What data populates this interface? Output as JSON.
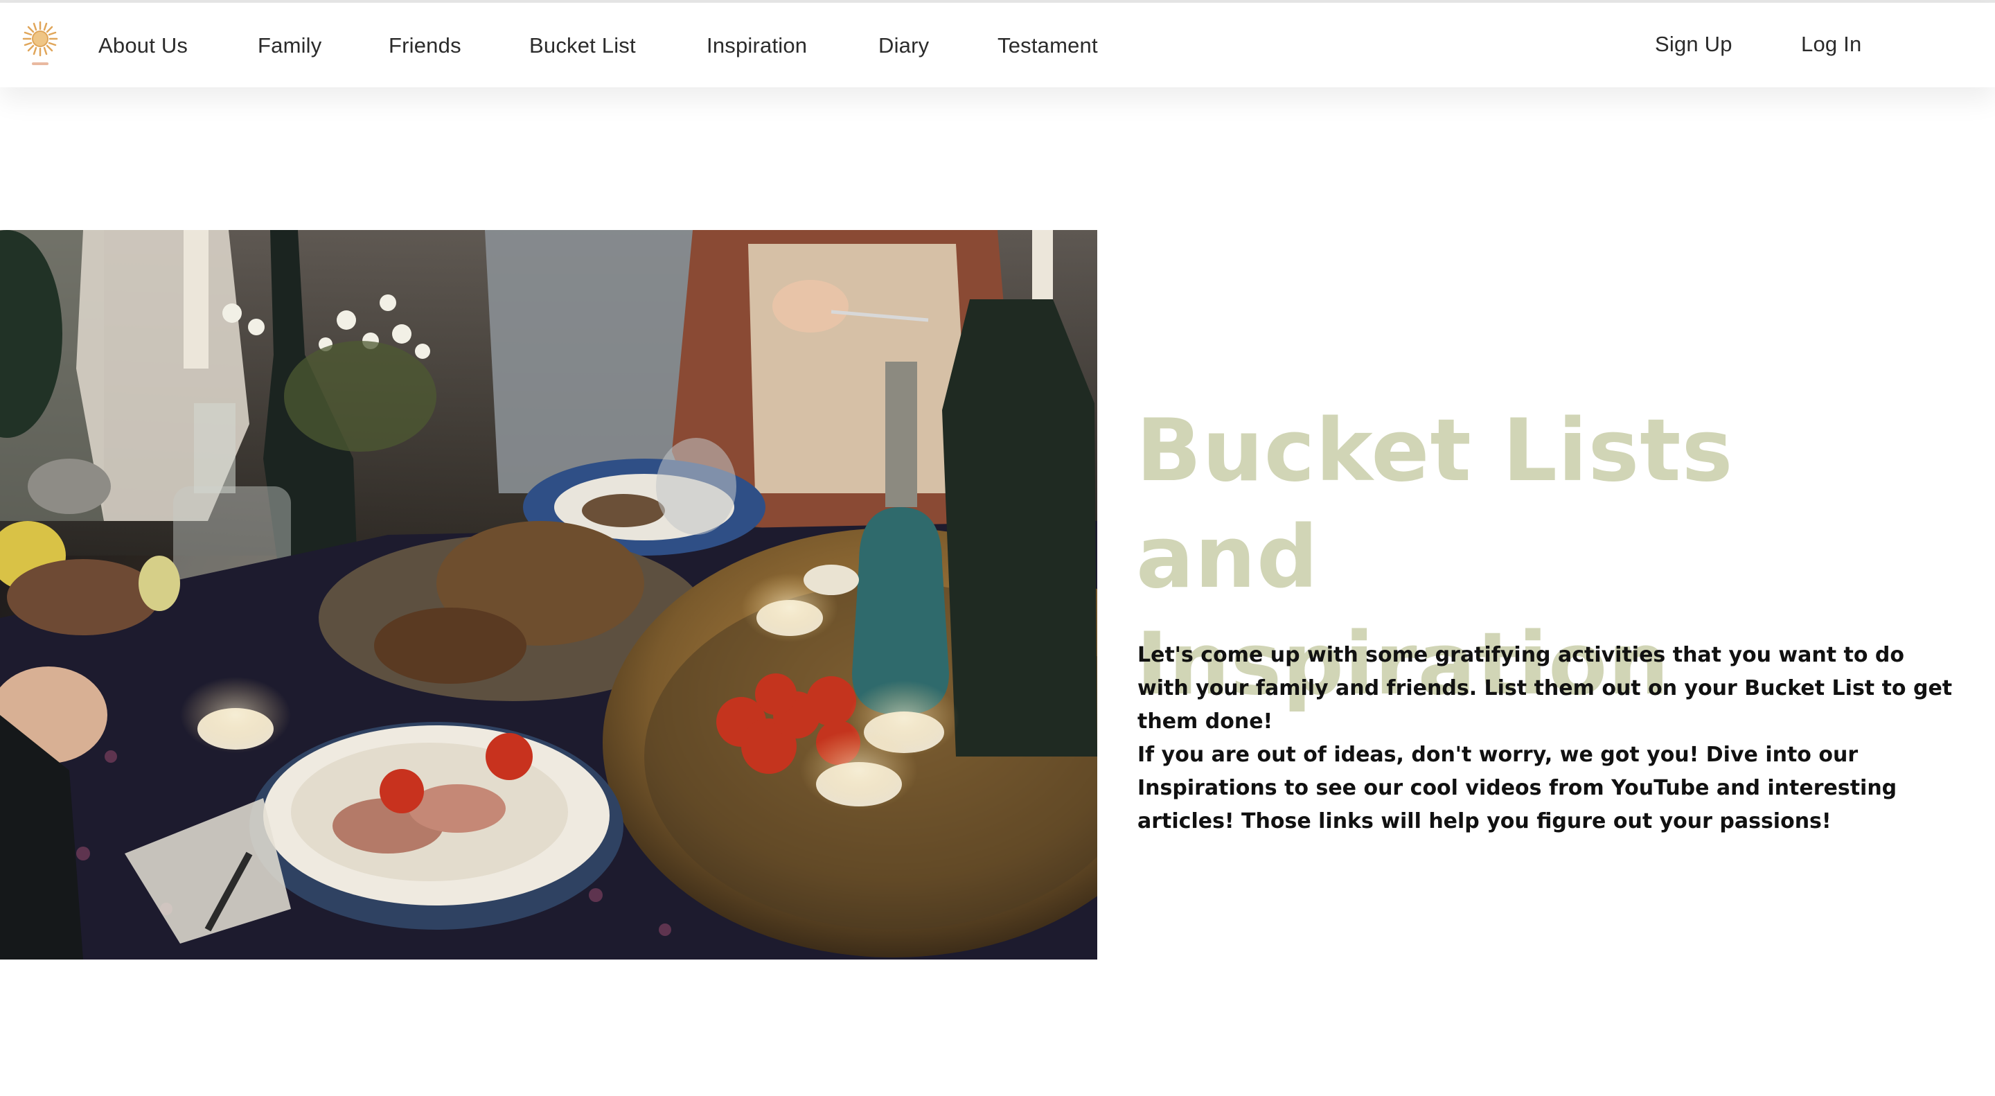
{
  "nav": {
    "logo_icon": "sun-logo-icon",
    "links": [
      {
        "label": "About Us"
      },
      {
        "label": "Family"
      },
      {
        "label": "Friends"
      },
      {
        "label": "Bucket List"
      },
      {
        "label": "Inspiration"
      },
      {
        "label": "Diary"
      },
      {
        "label": "Testament"
      }
    ],
    "sign_up": "Sign Up",
    "log_in": "Log In"
  },
  "hero": {
    "title_line1": "Bucket Lists and",
    "title_line2": "Inspiration",
    "paragraph1": "Let's come up with some gratifying activities that you want to do with your family and friends. List them out on your Bucket List to get them done!",
    "paragraph2": "If you are out of ideas, don't worry, we got you! Dive into our Inspirations to see our cool videos from YouTube and interesting articles! Those links will help you figure out your passions!",
    "image_subject": "dinner-table-photo"
  },
  "colors": {
    "title": "#d1d5b6",
    "nav_text": "#2b2b2b",
    "body_text": "#111111",
    "logo": "#e0a65a"
  }
}
